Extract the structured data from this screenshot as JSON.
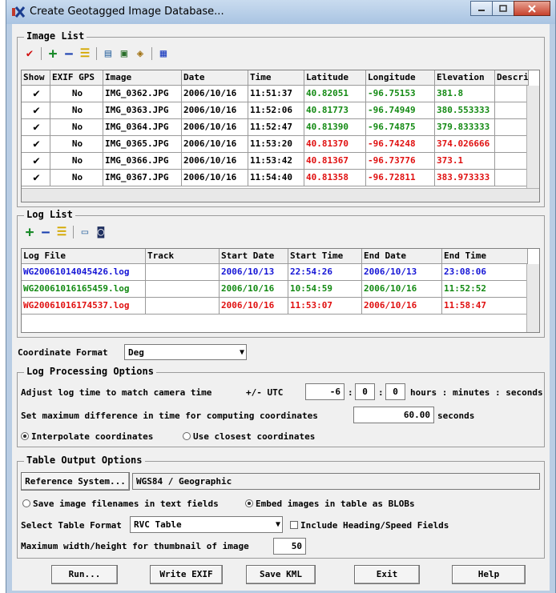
{
  "window": {
    "title": "Create Geotagged Image Database..."
  },
  "colors": {
    "green": "#138a13",
    "red": "#e01010",
    "blue": "#1515d6"
  },
  "image_list": {
    "title": "Image List",
    "columns": [
      "Show",
      "EXIF GPS",
      "Image",
      "Date",
      "Time",
      "Latitude",
      "Longitude",
      "Elevation",
      "Descri"
    ],
    "rows": [
      {
        "show": "✔",
        "exif": "No",
        "image": "IMG_0362.JPG",
        "date": "2006/10/16",
        "time": "11:51:37",
        "lat": "40.82051",
        "lon": "-96.75153",
        "elev": "381.8",
        "desc": "",
        "color": "green"
      },
      {
        "show": "✔",
        "exif": "No",
        "image": "IMG_0363.JPG",
        "date": "2006/10/16",
        "time": "11:52:06",
        "lat": "40.81773",
        "lon": "-96.74949",
        "elev": "380.553333",
        "desc": "",
        "color": "green"
      },
      {
        "show": "✔",
        "exif": "No",
        "image": "IMG_0364.JPG",
        "date": "2006/10/16",
        "time": "11:52:47",
        "lat": "40.81390",
        "lon": "-96.74875",
        "elev": "379.833333",
        "desc": "",
        "color": "green"
      },
      {
        "show": "✔",
        "exif": "No",
        "image": "IMG_0365.JPG",
        "date": "2006/10/16",
        "time": "11:53:20",
        "lat": "40.81370",
        "lon": "-96.74248",
        "elev": "374.026666",
        "desc": "",
        "color": "red"
      },
      {
        "show": "✔",
        "exif": "No",
        "image": "IMG_0366.JPG",
        "date": "2006/10/16",
        "time": "11:53:42",
        "lat": "40.81367",
        "lon": "-96.73776",
        "elev": "373.1",
        "desc": "",
        "color": "red"
      },
      {
        "show": "✔",
        "exif": "No",
        "image": "IMG_0367.JPG",
        "date": "2006/10/16",
        "time": "11:54:40",
        "lat": "40.81358",
        "lon": "-96.72811",
        "elev": "383.973333",
        "desc": "",
        "color": "red"
      }
    ]
  },
  "log_list": {
    "title": "Log List",
    "columns": [
      "Log File",
      "Track",
      "Start Date",
      "Start Time",
      "End Date",
      "End Time"
    ],
    "rows": [
      {
        "file": "WG20061014045426.log",
        "track": "",
        "start_date": "2006/10/13",
        "start_time": "22:54:26",
        "end_date": "2006/10/13",
        "end_time": "23:08:06",
        "color": "blue"
      },
      {
        "file": "WG20061016165459.log",
        "track": "",
        "start_date": "2006/10/16",
        "start_time": "10:54:59",
        "end_date": "2006/10/16",
        "end_time": "11:52:52",
        "color": "green"
      },
      {
        "file": "WG20061016174537.log",
        "track": "",
        "start_date": "2006/10/16",
        "start_time": "11:53:07",
        "end_date": "2006/10/16",
        "end_time": "11:58:47",
        "color": "red"
      }
    ]
  },
  "coordinate_format": {
    "label": "Coordinate Format",
    "value": "Deg"
  },
  "log_processing": {
    "title": "Log Processing Options",
    "adjust_label": "Adjust log time to match camera time",
    "utc_label": "+/- UTC",
    "hours": "-6",
    "minutes": "0",
    "seconds": "0",
    "units_label": "hours : minutes : seconds",
    "maxdiff_label": "Set maximum difference in time for computing coordinates",
    "maxdiff_value": "60.00",
    "maxdiff_units": "seconds",
    "interpolate_label": "Interpolate coordinates",
    "closest_label": "Use closest coordinates"
  },
  "table_output": {
    "title": "Table Output Options",
    "ref_button": "Reference System...",
    "ref_value": "WGS84 / Geographic",
    "save_filenames_label": "Save image filenames in text fields",
    "embed_label": "Embed images in table as BLOBs",
    "format_label": "Select Table Format",
    "format_value": "RVC Table",
    "heading_label": "Include Heading/Speed Fields",
    "thumb_label": "Maximum width/height for thumbnail of image",
    "thumb_value": "50"
  },
  "buttons": {
    "run": "Run...",
    "write_exif": "Write EXIF",
    "save_kml": "Save KML",
    "exit": "Exit",
    "help": "Help"
  }
}
